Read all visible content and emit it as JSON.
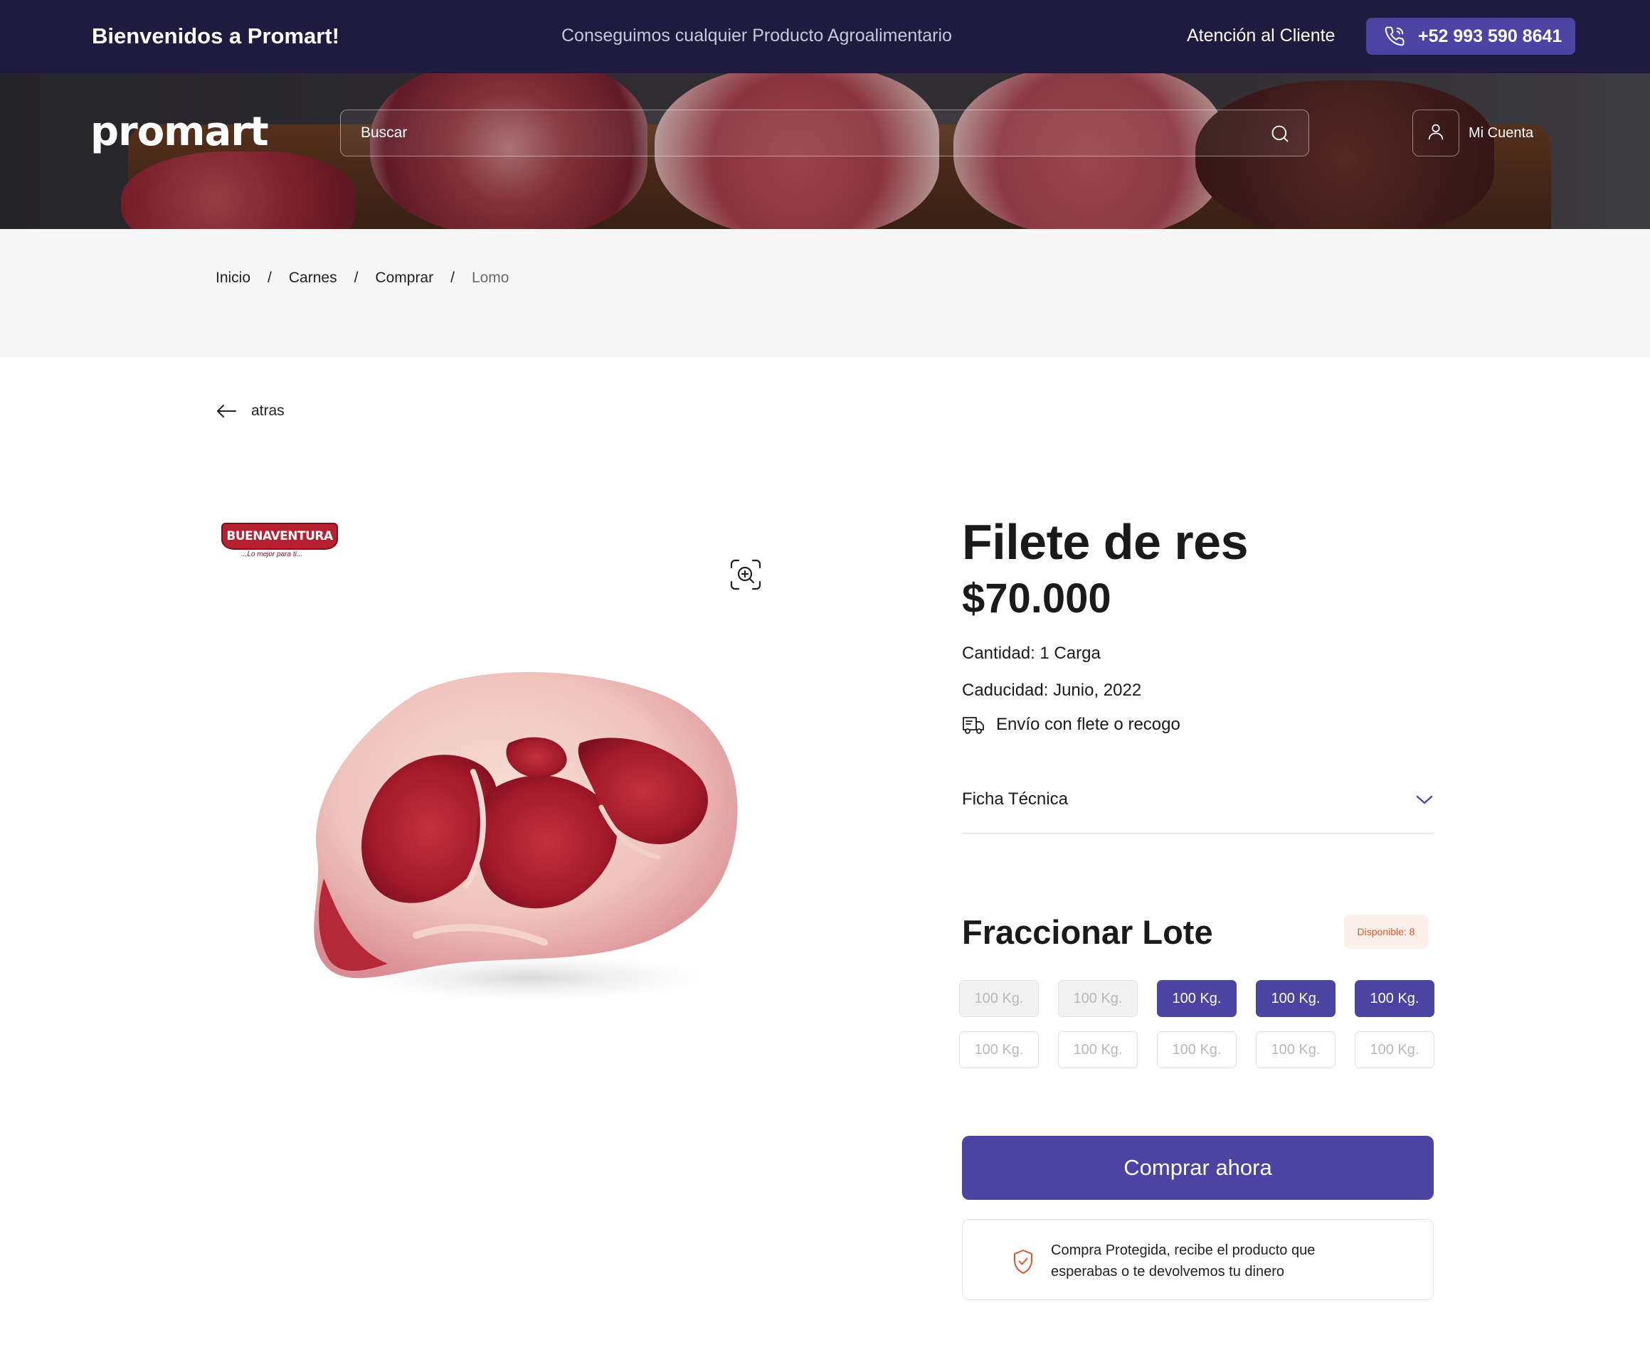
{
  "topbar": {
    "welcome": "Bienvenidos a Promart!",
    "tagline": "Conseguimos cualquier Producto Agroalimentario",
    "support_label": "Atención al Cliente",
    "phone": "+52 993 590 8641",
    "phone_icon": "phone-icon"
  },
  "header": {
    "logo": "promart",
    "search_placeholder": "Buscar",
    "search_icon": "search-icon",
    "account_label": "Mi Cuenta",
    "account_icon": "user-icon"
  },
  "breadcrumb": [
    "Inicio",
    "Carnes",
    "Comprar",
    "Lomo"
  ],
  "back_label": "atras",
  "brand": {
    "name": "BUENAVENTURA",
    "slogan": "...Lo mejor para ti..."
  },
  "product": {
    "title": "Filete de res",
    "price": "$70.000",
    "quantity": "Cantidad: 1 Carga",
    "expiry": "Caducidad: Junio, 2022",
    "shipping": "Envío con flete o recogo",
    "ficha_label": "Ficha Técnica"
  },
  "lote": {
    "title": "Fraccionar Lote",
    "available": "Disponible: 8",
    "chips": [
      {
        "label": "100 Kg.",
        "state": "disabled"
      },
      {
        "label": "100 Kg.",
        "state": "disabled"
      },
      {
        "label": "100 Kg.",
        "state": "selected"
      },
      {
        "label": "100 Kg.",
        "state": "selected"
      },
      {
        "label": "100 Kg.",
        "state": "selected"
      },
      {
        "label": "100 Kg.",
        "state": "available"
      },
      {
        "label": "100 Kg.",
        "state": "available"
      },
      {
        "label": "100 Kg.",
        "state": "available"
      },
      {
        "label": "100 Kg.",
        "state": "available"
      },
      {
        "label": "100 Kg.",
        "state": "available"
      }
    ]
  },
  "buy_label": "Comprar ahora",
  "protection_text": "Compra Protegida, recibe el producto que esperabas o te devolvemos tu dinero",
  "colors": {
    "topbar_bg": "#1e1b3f",
    "accent": "#4c44a3",
    "badge_text": "#e2552c",
    "badge_bg": "#fdf0ea"
  }
}
